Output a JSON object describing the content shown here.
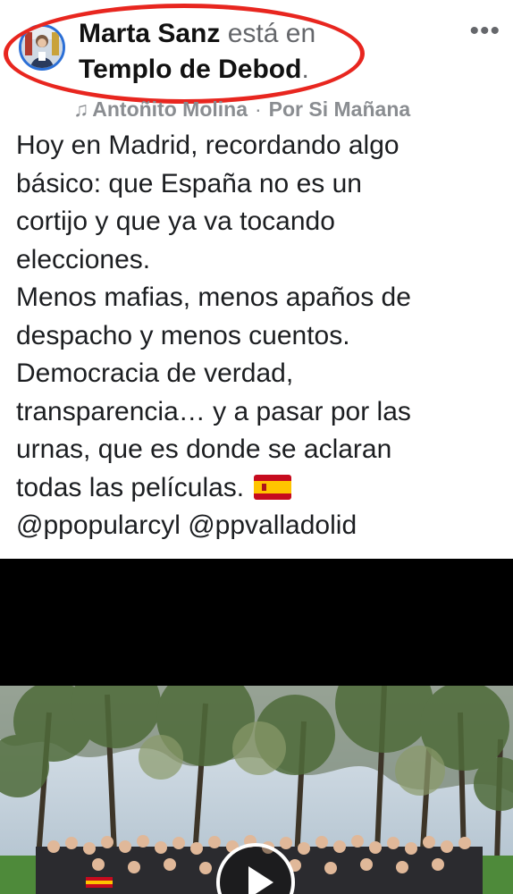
{
  "header": {
    "author_name": "Marta Sanz",
    "checkin_verb": "está en",
    "location": "Templo de Debod",
    "period": ".",
    "more_label": "•••",
    "avatar_icon": "profile-photo",
    "more_icon": "more-horizontal-icon"
  },
  "music": {
    "note_icon": "♫",
    "artist": "Antoñito Molina",
    "separator": "·",
    "song": "Por Si Mañana"
  },
  "post": {
    "lines": [
      "Hoy en Madrid, recordando algo",
      "básico: que España no es un",
      "cortijo y que ya va tocando",
      "elecciones.",
      "Menos mafias, menos apaños de",
      "despacho y menos cuentos.",
      "Democracia de verdad,",
      "transparencia… y a  pasar por las",
      "urnas, que es donde se aclaran",
      "todas las películas."
    ],
    "mentions": "@ppopularcyl @ppvalladolid",
    "flag_icon": "spain-flag-icon"
  },
  "video": {
    "play_icon": "play-icon"
  },
  "colors": {
    "highlight": "#e8261f",
    "avatar_ring": "#2b6fd6",
    "muted_text": "#65676b",
    "music_text": "#8a8d91"
  }
}
